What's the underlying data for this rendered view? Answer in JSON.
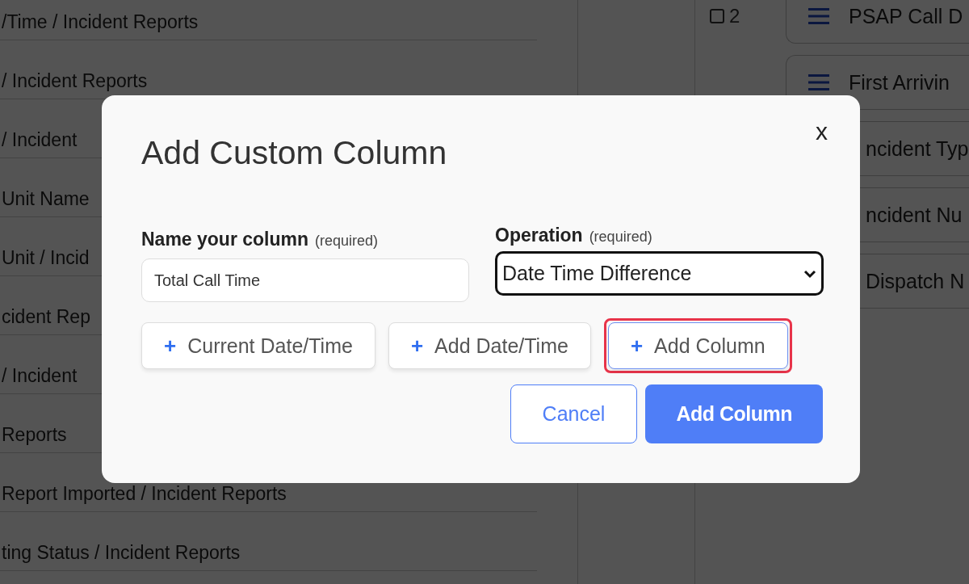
{
  "report_fields": [
    {
      "label": "/Time / Incident Reports"
    },
    {
      "label": "/ Incident Reports"
    },
    {
      "label": "/ Incident"
    },
    {
      "label": "Unit Name"
    },
    {
      "label": "Unit / Incid"
    },
    {
      "label": "cident Rep"
    },
    {
      "label": "/ Incident"
    },
    {
      "label": "Reports"
    },
    {
      "label": "Report Imported / Incident Reports"
    },
    {
      "label": "ting Status / Incident Reports"
    }
  ],
  "selected_columns": [
    {
      "number": "2",
      "checked": false,
      "label": "PSAP Call D",
      "kind": "handle"
    },
    {
      "label": "First Arrivin",
      "kind": "handle"
    },
    {
      "label": "ncident Typ",
      "kind": "text"
    },
    {
      "label": "ncident Nu",
      "kind": "text"
    },
    {
      "label": "Dispatch N",
      "kind": "text"
    }
  ],
  "dialog": {
    "title": "Add Custom Column",
    "close": "x",
    "name_field": {
      "label": "Name your column",
      "hint": "(required)",
      "value": "Total Call Time"
    },
    "operation_field": {
      "label": "Operation",
      "hint": "(required)",
      "value": "Date Time Difference"
    },
    "insert_buttons": [
      {
        "icon": "+",
        "label": "Current Date/Time",
        "highlighted": false
      },
      {
        "icon": "+",
        "label": "Add Date/Time",
        "highlighted": false
      },
      {
        "icon": "+",
        "label": "Add Column",
        "highlighted": true
      }
    ],
    "actions": [
      {
        "label": "Cancel",
        "kind": "secondary"
      },
      {
        "label": "Add Column",
        "kind": "primary"
      }
    ]
  }
}
